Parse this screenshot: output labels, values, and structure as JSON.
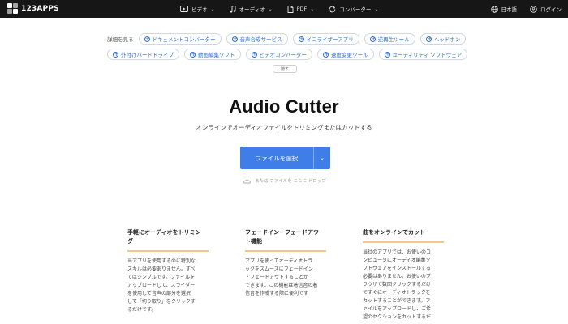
{
  "topbar": {
    "logo_text": "123APPS",
    "nav": [
      {
        "icon": "video-icon",
        "label": "ビデオ"
      },
      {
        "icon": "music-note-icon",
        "label": "オーディオ"
      },
      {
        "icon": "document-icon",
        "label": "PDF"
      },
      {
        "icon": "convert-icon",
        "label": "コンバーター"
      }
    ],
    "chevron": "⌄",
    "language_label": "日本語",
    "login_label": "ログイン"
  },
  "chips": {
    "see_more_label": "詳細を見る",
    "row1": [
      "ドキュメントコンバーター",
      "音声合成サービス",
      "イコライザーアプリ",
      "逆再生ツール",
      "ヘッドホン"
    ],
    "row2": [
      "外付けハードドライブ",
      "動画編集ソフト",
      "ビデオコンバーター",
      "速度変更ツール",
      "ユーティリティ ソフトウェア"
    ],
    "hide_label": "隠す"
  },
  "hero": {
    "title": "Audio Cutter",
    "subtitle": "オンラインでオーディオファイルをトリミングまたはカットする",
    "select_button": "ファイルを選択",
    "dropdown_glyph": "⌄",
    "drop_hint": "または ファイルを ここに ドロップ"
  },
  "features": [
    {
      "title_lines": [
        "手軽にオーディオをトリミン",
        "グ"
      ],
      "text_lines": [
        "当アプリを使用するのに特別な",
        "スキルは必要ありません。すべ",
        "てはシンプルです。ファイルを",
        "アップロードして、スライダー",
        "を使用して音声の部分を選択",
        "して「切り取り」をクリックす",
        "るだけです。"
      ]
    },
    {
      "title_lines": [
        "フェードイン・フェードアウ",
        "ト機能"
      ],
      "text_lines": [
        "アプリを使ってオーディオトラ",
        "ックをスムーズにフェードイン",
        "・フェードアウトすることが",
        "できます。この機能は着信音の着",
        "信音を作成する際に便利です"
      ]
    },
    {
      "title_lines": [
        "曲をオンラインでカット"
      ],
      "text_lines": [
        "当社のアプリでは、お使いのコ",
        "ンピュータにオーディオ編集ソ",
        "フトウェアをインストールする",
        "必要はありません。お使いのブ",
        "ラウザで数回クリックするだけ",
        "ですぐにオーディオトラックを",
        "カットすることができます。フ",
        "ァイルをアップロードし、ご希",
        "望のセクションをカットするだ"
      ]
    }
  ],
  "colors": {
    "topbar_bg": "#161616",
    "accent_blue": "#3f7ee8",
    "chip_text": "#2b6fd6",
    "card_underline": "#f1c88b"
  }
}
